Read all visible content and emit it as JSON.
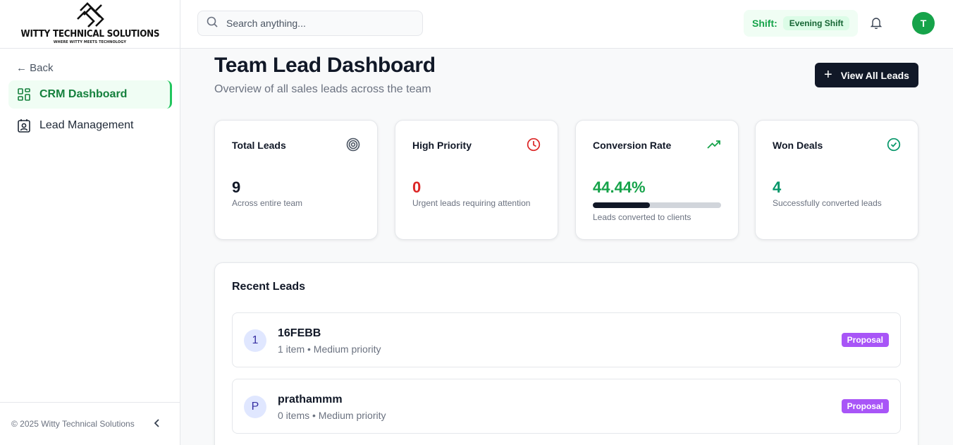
{
  "brand": {
    "name": "WITTY TECHNICAL SOLUTIONS",
    "tagline": "WHERE WITTY MEETS TECHNOLOGY"
  },
  "sidebar": {
    "back_label": "← Back",
    "items": [
      {
        "label": "CRM Dashboard",
        "icon": "dashboard-grid-icon",
        "active": true
      },
      {
        "label": "Lead Management",
        "icon": "contact-card-icon",
        "active": false
      }
    ],
    "footer": "© 2025 Witty Technical Solutions"
  },
  "header": {
    "search_placeholder": "Search anything...",
    "shift_label": "Shift:",
    "shift_value": "Evening Shift",
    "avatar_initial": "T"
  },
  "main": {
    "title": "Team Lead Dashboard",
    "subtitle": "Overview of all sales leads across the team",
    "view_all_label": "View All Leads",
    "stats": [
      {
        "title": "Total Leads",
        "value": "9",
        "desc": "Across entire team",
        "icon": "target-icon",
        "color": "#111827"
      },
      {
        "title": "High Priority",
        "value": "0",
        "desc": "Urgent leads requiring attention",
        "icon": "clock-icon",
        "color": "#dc2626"
      },
      {
        "title": "Conversion Rate",
        "value": "44.44%",
        "desc": "Leads converted to clients",
        "icon": "trending-up-icon",
        "color": "#16a34a",
        "progress": 0.4444
      },
      {
        "title": "Won Deals",
        "value": "4",
        "desc": "Successfully converted leads",
        "icon": "check-circle-icon",
        "color": "#059669"
      }
    ],
    "recent": {
      "title": "Recent Leads",
      "leads": [
        {
          "initial": "1",
          "name": "16FEBB",
          "meta": "1 item • Medium priority",
          "status": "Proposal"
        },
        {
          "initial": "P",
          "name": "prathammm",
          "meta": "0 items • Medium priority",
          "status": "Proposal"
        }
      ]
    }
  },
  "colors": {
    "accent": "#16a34a",
    "proposal_badge": "#a855f7",
    "avatar_bg": "#e0e7ff"
  }
}
